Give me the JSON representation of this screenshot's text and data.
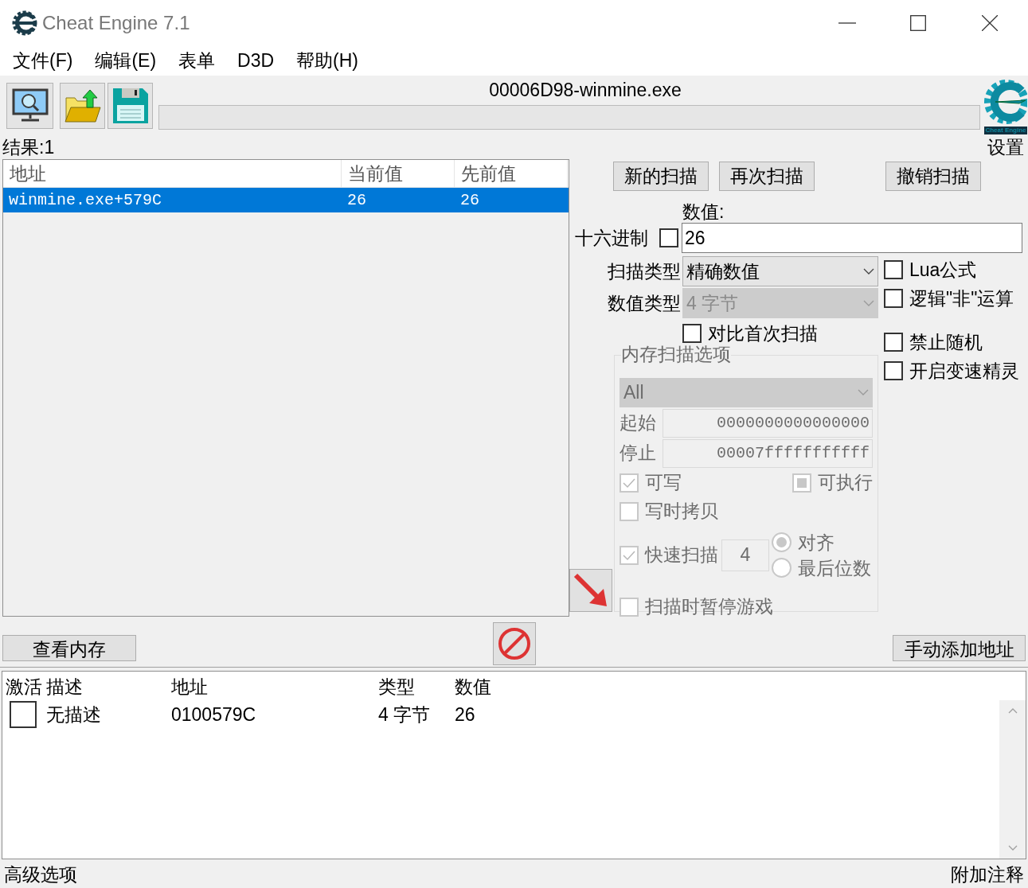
{
  "window": {
    "title": "Cheat Engine 7.1"
  },
  "menu": [
    {
      "label": "文件(F)"
    },
    {
      "label": "编辑(E)"
    },
    {
      "label": "表单"
    },
    {
      "label": "D3D"
    },
    {
      "label": "帮助(H)"
    }
  ],
  "toolbar": {
    "process_name": "00006D98-winmine.exe",
    "progress": {
      "level": 0
    },
    "logo_text": "Cheat Engine",
    "settings_label": "设置"
  },
  "results_label": "结果:1",
  "scan_results": {
    "columns": [
      "地址",
      "当前值",
      "先前值"
    ],
    "rows": [
      {
        "address": "winmine.exe+579C",
        "current": "26",
        "previous": "26",
        "selected": true
      }
    ]
  },
  "scan_buttons": [
    {
      "label": "新的扫描",
      "disabled": false
    },
    {
      "label": "再次扫描",
      "disabled": false
    },
    {
      "label": "撤销扫描",
      "disabled": false
    }
  ],
  "value": {
    "label": "数值:",
    "hex_label": "十六进制",
    "hex_checked": false,
    "value": "26"
  },
  "scan_type": {
    "label": "扫描类型",
    "value": "精确数值",
    "disabled": false
  },
  "value_type": {
    "label": "数值类型",
    "value": "4 字节",
    "disabled": true
  },
  "compare_first": {
    "label": "对比首次扫描",
    "checked": false
  },
  "options": [
    {
      "label": "Lua公式",
      "checked": false
    },
    {
      "label": "逻辑\"非\"运算",
      "checked": false
    },
    {
      "label": "禁止随机",
      "checked": false
    },
    {
      "label": "开启变速精灵",
      "checked": false
    }
  ],
  "memory_options": {
    "title": "内存扫描选项",
    "disabled": true,
    "region": "All",
    "start_label": "起始",
    "start": "0000000000000000",
    "stop_label": "停止",
    "stop": "00007fffffffffff",
    "writable": {
      "label": "可写",
      "checked": true
    },
    "executable": {
      "label": "可执行",
      "mixed": true
    },
    "copy_on_write": {
      "label": "写时拷贝",
      "checked": false
    },
    "fast_scan": {
      "label": "快速扫描",
      "checked": true,
      "step": "4"
    },
    "alignment": [
      {
        "label": "对齐",
        "selected": true
      },
      {
        "label": "最后位数",
        "selected": false
      }
    ],
    "pause_game": {
      "label": "扫描时暂停游戏",
      "checked": false
    }
  },
  "bottom_buttons": {
    "view_memory": "查看内存",
    "add_address": "手动添加地址"
  },
  "address_list": {
    "columns": [
      "激活",
      "描述",
      "地址",
      "类型",
      "数值"
    ],
    "rows": [
      {
        "active": false,
        "description": "无描述",
        "address": "0100579C",
        "type": "4 字节",
        "value": "26"
      }
    ]
  },
  "status_bar": {
    "left": "高级选项",
    "right": "附加注释"
  }
}
